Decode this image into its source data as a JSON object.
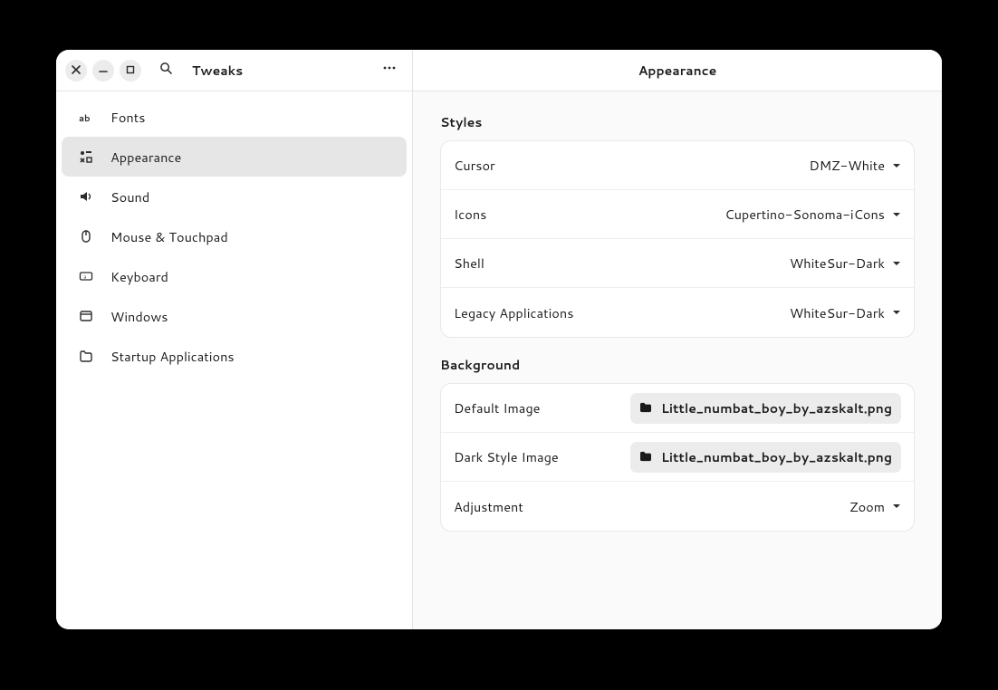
{
  "header": {
    "app_title": "Tweaks",
    "page_title": "Appearance"
  },
  "sidebar": {
    "items": [
      {
        "label": "Fonts"
      },
      {
        "label": "Appearance"
      },
      {
        "label": "Sound"
      },
      {
        "label": "Mouse & Touchpad"
      },
      {
        "label": "Keyboard"
      },
      {
        "label": "Windows"
      },
      {
        "label": "Startup Applications"
      }
    ]
  },
  "styles_section": {
    "title": "Styles",
    "rows": {
      "cursor": {
        "label": "Cursor",
        "value": "DMZ-White"
      },
      "icons": {
        "label": "Icons",
        "value": "Cupertino-Sonoma-iCons"
      },
      "shell": {
        "label": "Shell",
        "value": "WhiteSur-Dark"
      },
      "legacy": {
        "label": "Legacy Applications",
        "value": "WhiteSur-Dark"
      }
    }
  },
  "background_section": {
    "title": "Background",
    "rows": {
      "default_image": {
        "label": "Default Image",
        "file": "Little_numbat_boy_by_azskalt.png"
      },
      "dark_image": {
        "label": "Dark Style Image",
        "file": "Little_numbat_boy_by_azskalt.png"
      },
      "adjustment": {
        "label": "Adjustment",
        "value": "Zoom"
      }
    }
  }
}
